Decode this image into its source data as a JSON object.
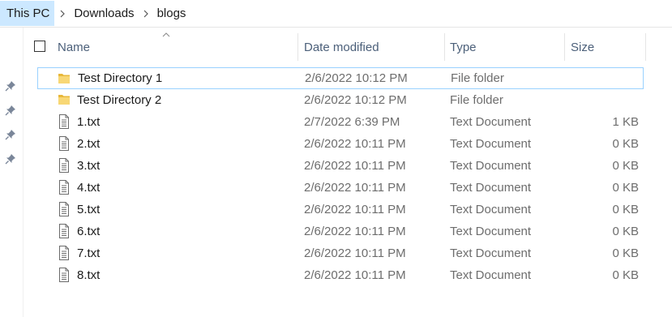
{
  "breadcrumb": {
    "items": [
      {
        "label": "This PC"
      },
      {
        "label": "Downloads"
      },
      {
        "label": "blogs"
      }
    ]
  },
  "columns": {
    "name": "Name",
    "date_modified": "Date modified",
    "type": "Type",
    "size": "Size"
  },
  "files": [
    {
      "name": "Test Directory 1",
      "date": "2/6/2022 10:12 PM",
      "type": "File folder",
      "size": "",
      "icon": "folder-icon",
      "selected": true
    },
    {
      "name": "Test Directory 2",
      "date": "2/6/2022 10:12 PM",
      "type": "File folder",
      "size": "",
      "icon": "folder-icon",
      "selected": false
    },
    {
      "name": "1.txt",
      "date": "2/7/2022 6:39 PM",
      "type": "Text Document",
      "size": "1 KB",
      "icon": "text-file-icon",
      "selected": false
    },
    {
      "name": "2.txt",
      "date": "2/6/2022 10:11 PM",
      "type": "Text Document",
      "size": "0 KB",
      "icon": "text-file-icon",
      "selected": false
    },
    {
      "name": "3.txt",
      "date": "2/6/2022 10:11 PM",
      "type": "Text Document",
      "size": "0 KB",
      "icon": "text-file-icon",
      "selected": false
    },
    {
      "name": "4.txt",
      "date": "2/6/2022 10:11 PM",
      "type": "Text Document",
      "size": "0 KB",
      "icon": "text-file-icon",
      "selected": false
    },
    {
      "name": "5.txt",
      "date": "2/6/2022 10:11 PM",
      "type": "Text Document",
      "size": "0 KB",
      "icon": "text-file-icon",
      "selected": false
    },
    {
      "name": "6.txt",
      "date": "2/6/2022 10:11 PM",
      "type": "Text Document",
      "size": "0 KB",
      "icon": "text-file-icon",
      "selected": false
    },
    {
      "name": "7.txt",
      "date": "2/6/2022 10:11 PM",
      "type": "Text Document",
      "size": "0 KB",
      "icon": "text-file-icon",
      "selected": false
    },
    {
      "name": "8.txt",
      "date": "2/6/2022 10:11 PM",
      "type": "Text Document",
      "size": "0 KB",
      "icon": "text-file-icon",
      "selected": false
    }
  ],
  "colors": {
    "selection_border": "#99d1ff",
    "breadcrumb_highlight": "#cce8ff",
    "folder_yellow": "#f8d775",
    "header_text": "#4c607a"
  }
}
